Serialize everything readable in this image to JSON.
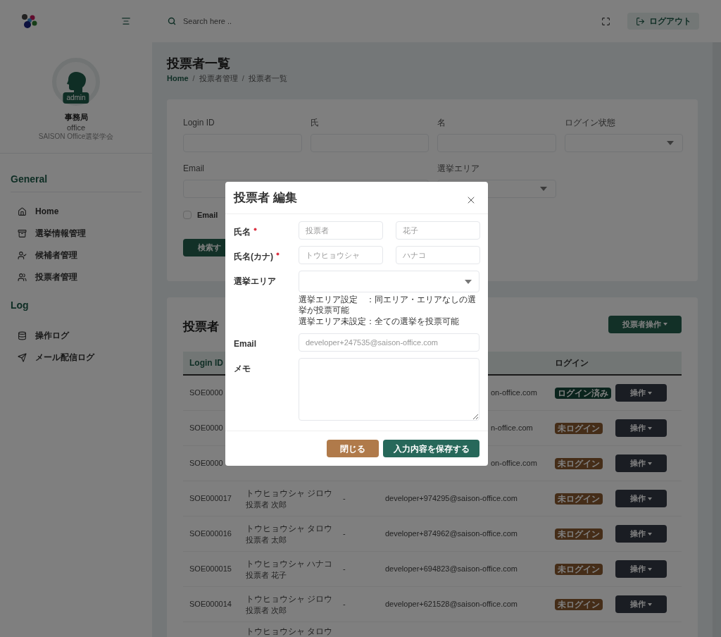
{
  "header": {
    "search_placeholder": "Search here ..",
    "logout": "ログアウト"
  },
  "sidebar": {
    "badge": "admin",
    "org": "事務局",
    "user": "office",
    "group": "SAISON Office選挙学会",
    "sections": [
      {
        "title": "General",
        "items": [
          {
            "kind": "home",
            "label": "Home"
          },
          {
            "kind": "archive",
            "label": "選挙情報管理"
          },
          {
            "kind": "user-check",
            "label": "候補者管理"
          },
          {
            "kind": "users",
            "label": "投票者管理"
          }
        ]
      },
      {
        "title": "Log",
        "items": [
          {
            "kind": "database",
            "label": "操作ログ"
          },
          {
            "kind": "send",
            "label": "メール配信ログ"
          }
        ]
      }
    ]
  },
  "page": {
    "title": "投票者一覧",
    "breadcrumb": [
      "Home",
      "投票者管理",
      "投票者一覧"
    ],
    "separator": "/"
  },
  "filters": {
    "fields": [
      {
        "kind": "text",
        "label": "Login ID"
      },
      {
        "kind": "text",
        "label": "氏"
      },
      {
        "kind": "text",
        "label": "名"
      },
      {
        "kind": "select",
        "label": "ログイン状態"
      },
      {
        "kind": "wide",
        "label": "Email"
      },
      {
        "kind": "select",
        "label": "選挙エリア"
      }
    ],
    "checkbox": {
      "label": "Email",
      "checked": false
    },
    "search_button": "検索す"
  },
  "list": {
    "title": "投票者",
    "action_button": "投票者操作",
    "columns": [
      "Login ID",
      "ログイン"
    ],
    "rows": [
      {
        "kind": "cut",
        "login_id": "SOE0000",
        "email": "on-office.com",
        "status": {
          "kind": "done",
          "label": "ログイン済み"
        },
        "action": "操作"
      },
      {
        "kind": "cut",
        "login_id": "SOE0000",
        "email": "n-office.com",
        "status": {
          "kind": "none",
          "label": "未ログイン"
        },
        "action": "操作"
      },
      {
        "kind": "cut",
        "login_id": "SOE0000",
        "email": "on-office.com",
        "status": {
          "kind": "none",
          "label": "未ログイン"
        },
        "action": "操作"
      },
      {
        "kind": "full",
        "login_id": "SOE000017",
        "kana": "トウヒョウシャ ジロウ",
        "name": "投票者 次郎",
        "memo": "-",
        "email": "developer+974295@saison-office.com",
        "status": {
          "kind": "none",
          "label": "未ログイン"
        },
        "action": "操作"
      },
      {
        "kind": "full",
        "login_id": "SOE000016",
        "kana": "トウヒョウシャ タロウ",
        "name": "投票者 太郎",
        "memo": "-",
        "email": "developer+874962@saison-office.com",
        "status": {
          "kind": "none",
          "label": "未ログイン"
        },
        "action": "操作"
      },
      {
        "kind": "full",
        "login_id": "SOE000015",
        "kana": "トウヒョウシャ ハナコ",
        "name": "投票者 花子",
        "memo": "-",
        "email": "developer+694823@saison-office.com",
        "status": {
          "kind": "none",
          "label": "未ログイン"
        },
        "action": "操作"
      },
      {
        "kind": "full",
        "login_id": "SOE000014",
        "kana": "トウヒョウシャ ジロウ",
        "name": "投票者 次郎",
        "memo": "-",
        "email": "developer+621528@saison-office.com",
        "status": {
          "kind": "none",
          "label": "未ログイン"
        },
        "action": "操作"
      },
      {
        "kind": "top",
        "kana": "トウヒョウシャ タロウ"
      }
    ]
  },
  "modal": {
    "title": "投票者 編集",
    "rows": [
      {
        "kind": "pair",
        "label": "氏名",
        "required": true,
        "values": [
          "投票者",
          "花子"
        ]
      },
      {
        "kind": "pair",
        "label": "氏名(カナ)",
        "required": true,
        "values": [
          "トウヒョウシャ",
          "ハナコ"
        ]
      },
      {
        "kind": "select",
        "label": "選挙エリア",
        "required": false,
        "notes": [
          "選挙エリア設定　：同エリア・エリアなしの選挙が投票可能",
          "選挙エリア未設定：全ての選挙を投票可能"
        ]
      },
      {
        "kind": "input",
        "label": "Email",
        "required": false,
        "placeholder": "developer+247535@saison-office.com"
      },
      {
        "kind": "textarea",
        "label": "メモ",
        "required": false
      }
    ],
    "close_button": "閉じる",
    "save_button": "入力内容を保存する"
  }
}
